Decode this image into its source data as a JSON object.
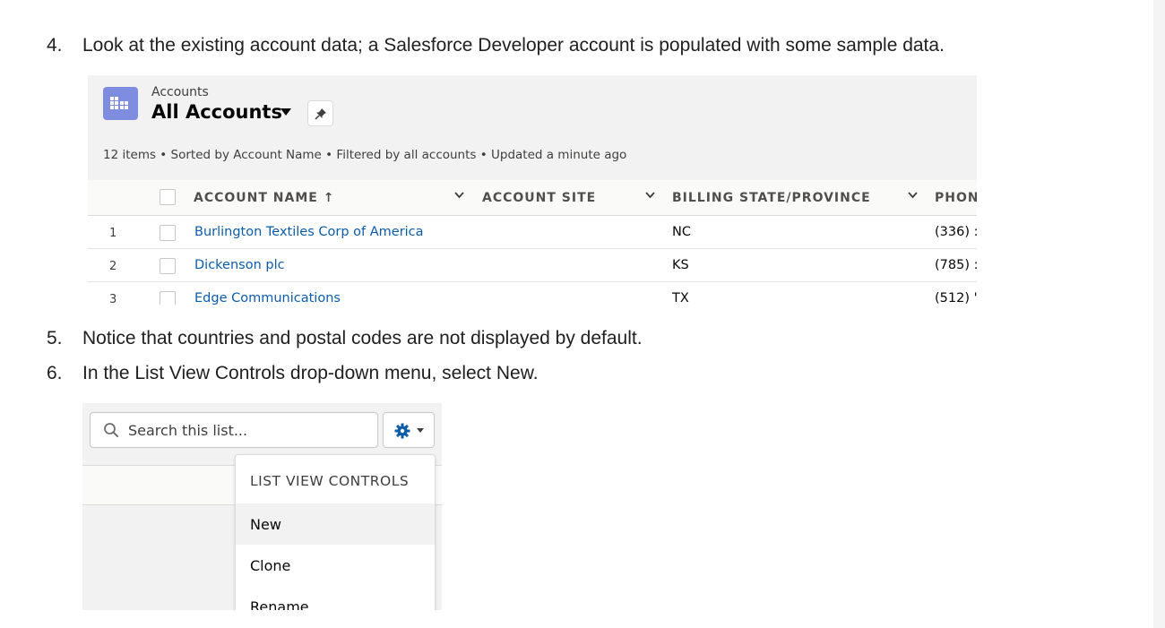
{
  "steps": [
    {
      "num": "4.",
      "text": "Look at the existing account data; a Salesforce Developer account is populated with some sample data."
    },
    {
      "num": "5.",
      "text": "Notice that countries and postal codes are not displayed by default."
    },
    {
      "num": "6.",
      "text": "In the List View Controls drop-down menu, select New."
    }
  ],
  "list_view": {
    "object_label": "Accounts",
    "title": "All Accounts",
    "meta": "12 items • Sorted by Account Name • Filtered by all accounts • Updated a minute ago",
    "columns": [
      {
        "label": "ACCOUNT NAME ↑"
      },
      {
        "label": "ACCOUNT SITE"
      },
      {
        "label": "BILLING STATE/PROVINCE"
      },
      {
        "label": "PHON"
      }
    ],
    "rows": [
      {
        "num": "1",
        "name": "Burlington Textiles Corp of America",
        "site": "",
        "state": "NC",
        "phone": "(336) :"
      },
      {
        "num": "2",
        "name": "Dickenson plc",
        "site": "",
        "state": "KS",
        "phone": "(785) :"
      },
      {
        "num": "3",
        "name": "Edge Communications",
        "site": "",
        "state": "TX",
        "phone": "(512) '"
      }
    ],
    "colors": {
      "link": "#0b5cab",
      "icon_bg": "#7f8de1",
      "header_bg": "#f3f2f2"
    }
  },
  "controls": {
    "search_placeholder": "Search this list...",
    "menu_header": "LIST VIEW CONTROLS",
    "menu_items": [
      {
        "label": "New",
        "highlighted": true
      },
      {
        "label": "Clone",
        "highlighted": false
      },
      {
        "label": "Rename",
        "highlighted": false
      }
    ]
  }
}
